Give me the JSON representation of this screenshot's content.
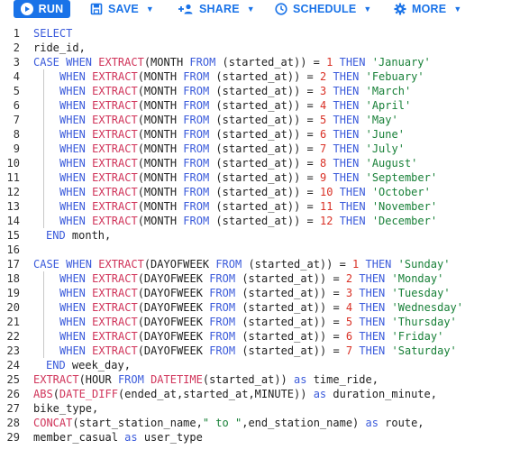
{
  "toolbar": {
    "run_label": "RUN",
    "save_label": "SAVE",
    "share_label": "SHARE",
    "schedule_label": "SCHEDULE",
    "more_label": "MORE"
  },
  "editor": {
    "lines": [
      {
        "n": "1",
        "tokens": [
          {
            "t": "SELECT",
            "c": "kw"
          }
        ]
      },
      {
        "n": "2",
        "tokens": [
          {
            "t": "ride_id,",
            "c": ""
          }
        ]
      },
      {
        "n": "3",
        "tokens": [
          {
            "t": "CASE ",
            "c": "kw"
          },
          {
            "t": "WHEN ",
            "c": "kw"
          },
          {
            "t": "EXTRACT",
            "c": "fn"
          },
          {
            "t": "(MONTH ",
            "c": ""
          },
          {
            "t": "FROM",
            "c": "kw"
          },
          {
            "t": " (started_at)) = ",
            "c": ""
          },
          {
            "t": "1",
            "c": "num"
          },
          {
            "t": " THEN ",
            "c": "kw"
          },
          {
            "t": "'January'",
            "c": "str"
          }
        ]
      },
      {
        "n": "4",
        "indent": true,
        "tokens": [
          {
            "t": "WHEN ",
            "c": "kw"
          },
          {
            "t": "EXTRACT",
            "c": "fn"
          },
          {
            "t": "(MONTH ",
            "c": ""
          },
          {
            "t": "FROM",
            "c": "kw"
          },
          {
            "t": " (started_at)) = ",
            "c": ""
          },
          {
            "t": "2",
            "c": "num"
          },
          {
            "t": " THEN ",
            "c": "kw"
          },
          {
            "t": "'Febuary'",
            "c": "str"
          }
        ]
      },
      {
        "n": "5",
        "indent": true,
        "tokens": [
          {
            "t": "WHEN ",
            "c": "kw"
          },
          {
            "t": "EXTRACT",
            "c": "fn"
          },
          {
            "t": "(MONTH ",
            "c": ""
          },
          {
            "t": "FROM",
            "c": "kw"
          },
          {
            "t": " (started_at)) = ",
            "c": ""
          },
          {
            "t": "3",
            "c": "num"
          },
          {
            "t": " THEN ",
            "c": "kw"
          },
          {
            "t": "'March'",
            "c": "str"
          }
        ]
      },
      {
        "n": "6",
        "indent": true,
        "tokens": [
          {
            "t": "WHEN ",
            "c": "kw"
          },
          {
            "t": "EXTRACT",
            "c": "fn"
          },
          {
            "t": "(MONTH ",
            "c": ""
          },
          {
            "t": "FROM",
            "c": "kw"
          },
          {
            "t": " (started_at)) = ",
            "c": ""
          },
          {
            "t": "4",
            "c": "num"
          },
          {
            "t": " THEN ",
            "c": "kw"
          },
          {
            "t": "'April'",
            "c": "str"
          }
        ]
      },
      {
        "n": "7",
        "indent": true,
        "tokens": [
          {
            "t": "WHEN ",
            "c": "kw"
          },
          {
            "t": "EXTRACT",
            "c": "fn"
          },
          {
            "t": "(MONTH ",
            "c": ""
          },
          {
            "t": "FROM",
            "c": "kw"
          },
          {
            "t": " (started_at)) = ",
            "c": ""
          },
          {
            "t": "5",
            "c": "num"
          },
          {
            "t": " THEN ",
            "c": "kw"
          },
          {
            "t": "'May'",
            "c": "str"
          }
        ]
      },
      {
        "n": "8",
        "indent": true,
        "tokens": [
          {
            "t": "WHEN ",
            "c": "kw"
          },
          {
            "t": "EXTRACT",
            "c": "fn"
          },
          {
            "t": "(MONTH ",
            "c": ""
          },
          {
            "t": "FROM",
            "c": "kw"
          },
          {
            "t": " (started_at)) = ",
            "c": ""
          },
          {
            "t": "6",
            "c": "num"
          },
          {
            "t": " THEN ",
            "c": "kw"
          },
          {
            "t": "'June'",
            "c": "str"
          }
        ]
      },
      {
        "n": "9",
        "indent": true,
        "tokens": [
          {
            "t": "WHEN ",
            "c": "kw"
          },
          {
            "t": "EXTRACT",
            "c": "fn"
          },
          {
            "t": "(MONTH ",
            "c": ""
          },
          {
            "t": "FROM",
            "c": "kw"
          },
          {
            "t": " (started_at)) = ",
            "c": ""
          },
          {
            "t": "7",
            "c": "num"
          },
          {
            "t": " THEN ",
            "c": "kw"
          },
          {
            "t": "'July'",
            "c": "str"
          }
        ]
      },
      {
        "n": "10",
        "indent": true,
        "tokens": [
          {
            "t": "WHEN ",
            "c": "kw"
          },
          {
            "t": "EXTRACT",
            "c": "fn"
          },
          {
            "t": "(MONTH ",
            "c": ""
          },
          {
            "t": "FROM",
            "c": "kw"
          },
          {
            "t": " (started_at)) = ",
            "c": ""
          },
          {
            "t": "8",
            "c": "num"
          },
          {
            "t": " THEN ",
            "c": "kw"
          },
          {
            "t": "'August'",
            "c": "str"
          }
        ]
      },
      {
        "n": "11",
        "indent": true,
        "tokens": [
          {
            "t": "WHEN ",
            "c": "kw"
          },
          {
            "t": "EXTRACT",
            "c": "fn"
          },
          {
            "t": "(MONTH ",
            "c": ""
          },
          {
            "t": "FROM",
            "c": "kw"
          },
          {
            "t": " (started_at)) = ",
            "c": ""
          },
          {
            "t": "9",
            "c": "num"
          },
          {
            "t": " THEN ",
            "c": "kw"
          },
          {
            "t": "'September'",
            "c": "str"
          }
        ]
      },
      {
        "n": "12",
        "indent": true,
        "tokens": [
          {
            "t": "WHEN ",
            "c": "kw"
          },
          {
            "t": "EXTRACT",
            "c": "fn"
          },
          {
            "t": "(MONTH ",
            "c": ""
          },
          {
            "t": "FROM",
            "c": "kw"
          },
          {
            "t": " (started_at)) = ",
            "c": ""
          },
          {
            "t": "10",
            "c": "num"
          },
          {
            "t": " THEN ",
            "c": "kw"
          },
          {
            "t": "'October'",
            "c": "str"
          }
        ]
      },
      {
        "n": "13",
        "indent": true,
        "tokens": [
          {
            "t": "WHEN ",
            "c": "kw"
          },
          {
            "t": "EXTRACT",
            "c": "fn"
          },
          {
            "t": "(MONTH ",
            "c": ""
          },
          {
            "t": "FROM",
            "c": "kw"
          },
          {
            "t": " (started_at)) = ",
            "c": ""
          },
          {
            "t": "11",
            "c": "num"
          },
          {
            "t": " THEN ",
            "c": "kw"
          },
          {
            "t": "'November'",
            "c": "str"
          }
        ]
      },
      {
        "n": "14",
        "indent": true,
        "tokens": [
          {
            "t": "WHEN ",
            "c": "kw"
          },
          {
            "t": "EXTRACT",
            "c": "fn"
          },
          {
            "t": "(MONTH ",
            "c": ""
          },
          {
            "t": "FROM",
            "c": "kw"
          },
          {
            "t": " (started_at)) = ",
            "c": ""
          },
          {
            "t": "12",
            "c": "num"
          },
          {
            "t": " THEN ",
            "c": "kw"
          },
          {
            "t": "'December'",
            "c": "str"
          }
        ]
      },
      {
        "n": "15",
        "half": true,
        "tokens": [
          {
            "t": "END",
            "c": "kw"
          },
          {
            "t": " month,",
            "c": ""
          }
        ]
      },
      {
        "n": "16",
        "tokens": []
      },
      {
        "n": "17",
        "tokens": [
          {
            "t": "CASE ",
            "c": "kw"
          },
          {
            "t": "WHEN ",
            "c": "kw"
          },
          {
            "t": "EXTRACT",
            "c": "fn"
          },
          {
            "t": "(DAYOFWEEK ",
            "c": ""
          },
          {
            "t": "FROM",
            "c": "kw"
          },
          {
            "t": " (started_at)) = ",
            "c": ""
          },
          {
            "t": "1",
            "c": "num"
          },
          {
            "t": " THEN ",
            "c": "kw"
          },
          {
            "t": "'Sunday'",
            "c": "str"
          }
        ]
      },
      {
        "n": "18",
        "indent": true,
        "tokens": [
          {
            "t": "WHEN ",
            "c": "kw"
          },
          {
            "t": "EXTRACT",
            "c": "fn"
          },
          {
            "t": "(DAYOFWEEK ",
            "c": ""
          },
          {
            "t": "FROM",
            "c": "kw"
          },
          {
            "t": " (started_at)) = ",
            "c": ""
          },
          {
            "t": "2",
            "c": "num"
          },
          {
            "t": " THEN ",
            "c": "kw"
          },
          {
            "t": "'Monday'",
            "c": "str"
          }
        ]
      },
      {
        "n": "19",
        "indent": true,
        "tokens": [
          {
            "t": "WHEN ",
            "c": "kw"
          },
          {
            "t": "EXTRACT",
            "c": "fn"
          },
          {
            "t": "(DAYOFWEEK ",
            "c": ""
          },
          {
            "t": "FROM",
            "c": "kw"
          },
          {
            "t": " (started_at)) = ",
            "c": ""
          },
          {
            "t": "3",
            "c": "num"
          },
          {
            "t": " THEN ",
            "c": "kw"
          },
          {
            "t": "'Tuesday'",
            "c": "str"
          }
        ]
      },
      {
        "n": "20",
        "indent": true,
        "tokens": [
          {
            "t": "WHEN ",
            "c": "kw"
          },
          {
            "t": "EXTRACT",
            "c": "fn"
          },
          {
            "t": "(DAYOFWEEK ",
            "c": ""
          },
          {
            "t": "FROM",
            "c": "kw"
          },
          {
            "t": " (started_at)) = ",
            "c": ""
          },
          {
            "t": "4",
            "c": "num"
          },
          {
            "t": " THEN ",
            "c": "kw"
          },
          {
            "t": "'Wednesday'",
            "c": "str"
          }
        ]
      },
      {
        "n": "21",
        "indent": true,
        "tokens": [
          {
            "t": "WHEN ",
            "c": "kw"
          },
          {
            "t": "EXTRACT",
            "c": "fn"
          },
          {
            "t": "(DAYOFWEEK ",
            "c": ""
          },
          {
            "t": "FROM",
            "c": "kw"
          },
          {
            "t": " (started_at)) = ",
            "c": ""
          },
          {
            "t": "5",
            "c": "num"
          },
          {
            "t": " THEN ",
            "c": "kw"
          },
          {
            "t": "'Thursday'",
            "c": "str"
          }
        ]
      },
      {
        "n": "22",
        "indent": true,
        "tokens": [
          {
            "t": "WHEN ",
            "c": "kw"
          },
          {
            "t": "EXTRACT",
            "c": "fn"
          },
          {
            "t": "(DAYOFWEEK ",
            "c": ""
          },
          {
            "t": "FROM",
            "c": "kw"
          },
          {
            "t": " (started_at)) = ",
            "c": ""
          },
          {
            "t": "6",
            "c": "num"
          },
          {
            "t": " THEN ",
            "c": "kw"
          },
          {
            "t": "'Friday'",
            "c": "str"
          }
        ]
      },
      {
        "n": "23",
        "indent": true,
        "tokens": [
          {
            "t": "WHEN ",
            "c": "kw"
          },
          {
            "t": "EXTRACT",
            "c": "fn"
          },
          {
            "t": "(DAYOFWEEK ",
            "c": ""
          },
          {
            "t": "FROM",
            "c": "kw"
          },
          {
            "t": " (started_at)) = ",
            "c": ""
          },
          {
            "t": "7",
            "c": "num"
          },
          {
            "t": " THEN ",
            "c": "kw"
          },
          {
            "t": "'Saturday'",
            "c": "str"
          }
        ]
      },
      {
        "n": "24",
        "half": true,
        "tokens": [
          {
            "t": "END",
            "c": "kw"
          },
          {
            "t": " week_day,",
            "c": ""
          }
        ]
      },
      {
        "n": "25",
        "tokens": [
          {
            "t": "EXTRACT",
            "c": "fn"
          },
          {
            "t": "(HOUR ",
            "c": ""
          },
          {
            "t": "FROM ",
            "c": "kw"
          },
          {
            "t": "DATETIME",
            "c": "fn"
          },
          {
            "t": "(started_at)) ",
            "c": ""
          },
          {
            "t": "as",
            "c": "kw"
          },
          {
            "t": " time_ride,",
            "c": ""
          }
        ]
      },
      {
        "n": "26",
        "tokens": [
          {
            "t": "ABS",
            "c": "fn"
          },
          {
            "t": "(",
            "c": ""
          },
          {
            "t": "DATE_DIFF",
            "c": "fn"
          },
          {
            "t": "(ended_at,started_at,MINUTE)) ",
            "c": ""
          },
          {
            "t": "as",
            "c": "kw"
          },
          {
            "t": " duration_minute,",
            "c": ""
          }
        ]
      },
      {
        "n": "27",
        "tokens": [
          {
            "t": "bike_type,",
            "c": ""
          }
        ]
      },
      {
        "n": "28",
        "tokens": [
          {
            "t": "CONCAT",
            "c": "fn"
          },
          {
            "t": "(start_station_name,",
            "c": ""
          },
          {
            "t": "\" to \"",
            "c": "str"
          },
          {
            "t": ",end_station_name) ",
            "c": ""
          },
          {
            "t": "as",
            "c": "kw"
          },
          {
            "t": " route,",
            "c": ""
          }
        ]
      },
      {
        "n": "29",
        "tokens": [
          {
            "t": "member_casual ",
            "c": ""
          },
          {
            "t": "as",
            "c": "kw"
          },
          {
            "t": " user_type",
            "c": ""
          }
        ]
      }
    ]
  }
}
